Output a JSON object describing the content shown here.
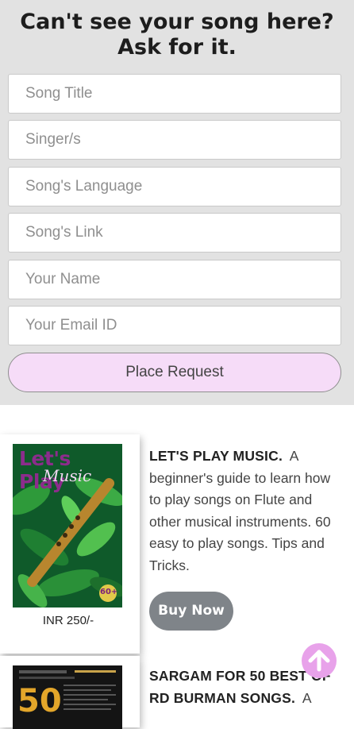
{
  "request_form": {
    "title_line1": "Can't see your song here?",
    "title_line2": "Ask for it.",
    "song_title_placeholder": "Song Title",
    "singers_placeholder": "Singer/s",
    "language_placeholder": "Song's Language",
    "link_placeholder": "Song's Link",
    "name_placeholder": "Your Name",
    "email_placeholder": "Your Email ID",
    "submit_label": "Place Request"
  },
  "products": [
    {
      "cover_title_line1": "Let's Play",
      "cover_title_line2": "Music",
      "cover_badge": "60+",
      "price": "INR 250/-",
      "name": "LET'S PLAY MUSIC.",
      "description": "A beginner's guide to learn how to play songs on Flute and other musical instruments. 60 easy to play songs. Tips and Tricks.",
      "buy_label": "Buy Now"
    },
    {
      "cover_number": "50",
      "name_line1": "SARGAM FOR 50 BEST OF",
      "name_line2": "RD BURMAN SONGS.",
      "description_start": "A"
    }
  ],
  "scroll_top": {
    "icon": "arrow-up-icon",
    "color": "#e8a2ea"
  },
  "colors": {
    "form_background": "#e2e2e2",
    "request_button": "#f6dcf8",
    "buy_button": "#7f8489"
  }
}
